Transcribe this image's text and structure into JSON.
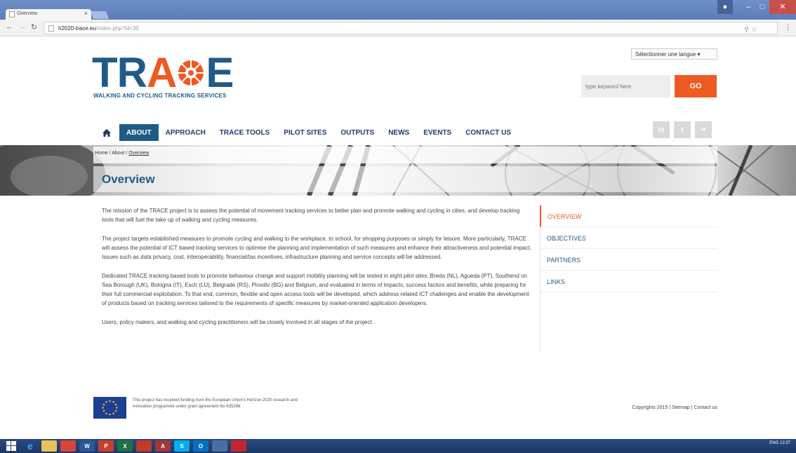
{
  "browser": {
    "tab_title": "Overview",
    "tab_close": "×",
    "url_domain": "h2020-trace.eu",
    "url_path": "/index.php?id=30"
  },
  "header": {
    "language_select": "Sélectionner une langue",
    "logo_part1": "TR",
    "logo_part2": "A",
    "logo_part3": "E",
    "logo_tagline": "WALKING AND CYCLING TRACKING SERVICES",
    "search_placeholder": "type keyword here",
    "go_label": "GO"
  },
  "nav": {
    "items": [
      "ABOUT",
      "APPROACH",
      "TRACE TOOLS",
      "PILOT SITES",
      "OUTPUTS",
      "NEWS",
      "EVENTS",
      "CONTACT US"
    ]
  },
  "social": {
    "linkedin": "in",
    "twitter": "t",
    "flickr": "••"
  },
  "breadcrumb": {
    "home": "Home",
    "about": "About",
    "current": "Overview",
    "sep": " / "
  },
  "page": {
    "title": "Overview",
    "paragraphs": [
      "The mission of the TRACE project is to assess the potential of movement tracking services to better plan and promote walking and cycling in cities, and develop tracking tools that will fuel the take up of walking and cycling measures.",
      "The project targets established measures to promote cycling and walking to the workplace, to school, for shopping purposes or simply for leisure. More particularly, TRACE will assess the potential of ICT based tracking services to optimise the planning and implementation of such measures and enhance their attractiveness and potential impact. Issues such as data privacy, cost, interoperability, financial/tax incentives, infrastructure planning and service concepts will be addressed.",
      "Dedicated TRACE tracking based tools to promote behaviour change and support mobility planning will be tested in eight pilot sites: Breda (NL), Agueda (PT), Southend on Sea Borough (UK), Bologna (IT), Esch (LU), Belgrade (RS), Plovdiv (BG) and Belgium, and evaluated in terms of impacts, success factors and benefits, while preparing for their full commercial exploitation. To that end, common, flexible and open access tools will be developed, which address related ICT challenges and enable the development of products based on tracking services tailored to the requirements of specific measures by market-oriented application developers.",
      "Users, policy makers, and walking and cycling practitioners will be closely involved in all stages of the project."
    ]
  },
  "sidenav": {
    "items": [
      "OVERVIEW",
      "OBJECTIVES",
      "PARTNERS",
      "LINKS"
    ]
  },
  "footer": {
    "funding_text": "This project has received funding from the European Union's Horizon 2020 research and innovation programme under grant agreement No 635266",
    "copyright": "Copyrights 2015 | Sitemap | Contact us"
  },
  "taskbar": {
    "language": "ENG",
    "time": "12:37"
  },
  "colors": {
    "brand_blue": "#1f5b86",
    "accent_orange": "#ee5a22"
  }
}
